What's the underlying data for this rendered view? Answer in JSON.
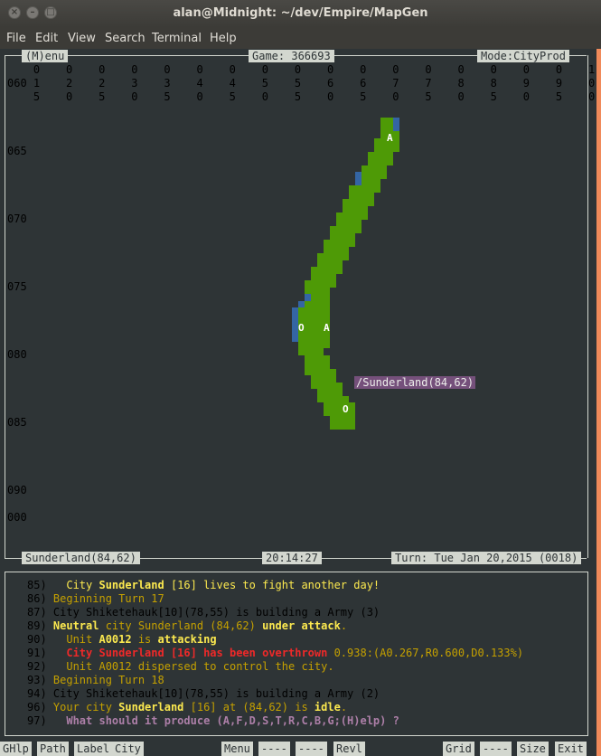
{
  "window": {
    "title": "alan@Midnight: ~/dev/Empire/MapGen",
    "menu": [
      "File",
      "Edit",
      "View",
      "Search",
      "Terminal",
      "Help"
    ]
  },
  "header": {
    "menu_label": "(M)enu",
    "game": "Game: 366693",
    "mode": "Mode:CityProd"
  },
  "columns": {
    "row0": "    0    0    0    0    0    0    0    0    0    0    0    0    0    0    0    0    0    1",
    "row1": "060 1    2    2    3    3    4    4    5    5    6    6    7    7    8    8    9    9    0",
    "row2": "    5    0    5    0    5    0    5    0    5    0    5    0    5    0    5    0    5    0"
  },
  "row_labels": [
    "065",
    "070",
    "075",
    "080",
    "085",
    "090",
    "000"
  ],
  "map": {
    "units": [
      {
        "glyph": "A"
      },
      {
        "glyph": "O"
      },
      {
        "glyph": "A"
      },
      {
        "glyph": "O"
      }
    ],
    "city_label": "/Sunderland(84,62)"
  },
  "status": {
    "location": "Sunderland(84,62)",
    "time": "20:14:27",
    "turn": "Turn: Tue Jan 20,2015 (0018)"
  },
  "log": [
    {
      "num": "85)",
      "indent": "  ",
      "parts": [
        {
          "t": "City ",
          "c": "yel"
        },
        {
          "t": "Sunderland",
          "c": "yel bold"
        },
        {
          "t": " [16] lives to fight another day!",
          "c": "yel"
        }
      ]
    },
    {
      "num": "86)",
      "indent": "",
      "parts": [
        {
          "t": "Beginning Turn 17",
          "c": "yel2"
        }
      ]
    },
    {
      "num": "87)",
      "indent": "",
      "parts": [
        {
          "t": "City Shiketehauk[10](78,55) is building a Army (3)",
          "c": ""
        }
      ]
    },
    {
      "num": "89)",
      "indent": "",
      "parts": [
        {
          "t": "Neutral",
          "c": "yel bold"
        },
        {
          "t": " city Sunderland (84,62) ",
          "c": "yel2"
        },
        {
          "t": "under attack",
          "c": "yel bold"
        },
        {
          "t": ".",
          "c": "yel2"
        }
      ]
    },
    {
      "num": "90)",
      "indent": "  ",
      "parts": [
        {
          "t": "Unit ",
          "c": "yel2"
        },
        {
          "t": "A0012",
          "c": "yel bold"
        },
        {
          "t": " is ",
          "c": "yel2"
        },
        {
          "t": "attacking",
          "c": "yel bold"
        }
      ]
    },
    {
      "num": "91)",
      "indent": "  ",
      "parts": [
        {
          "t": "City Sunderland [16] has been overthrown",
          "c": "red bold"
        },
        {
          "t": " 0.938:(A0.267,R0.600,D0.133%)",
          "c": "yel2"
        }
      ]
    },
    {
      "num": "92)",
      "indent": "  ",
      "parts": [
        {
          "t": "Unit A0012 dispersed to control the city.",
          "c": "yel2"
        }
      ]
    },
    {
      "num": "93)",
      "indent": "",
      "parts": [
        {
          "t": "Beginning Turn 18",
          "c": "yel2"
        }
      ]
    },
    {
      "num": "94)",
      "indent": "",
      "parts": [
        {
          "t": "City Shiketehauk[10](78,55) is building a Army (2)",
          "c": ""
        }
      ]
    },
    {
      "num": "96)",
      "indent": "",
      "parts": [
        {
          "t": "Your city ",
          "c": "yel2"
        },
        {
          "t": "Sunderland",
          "c": "yel bold"
        },
        {
          "t": " [16] at (84,62) is ",
          "c": "yel2"
        },
        {
          "t": "idle",
          "c": "yel bold"
        },
        {
          "t": ".",
          "c": "yel2"
        }
      ]
    },
    {
      "num": "97)",
      "indent": "  ",
      "parts": [
        {
          "t": "What should it produce (A,F,D,S,T,R,C,B,G;(H)elp) ?",
          "c": "pink bold"
        }
      ]
    }
  ],
  "function_keys": [
    "GHlp",
    "Path",
    "Label",
    "City",
    "Menu",
    "----",
    "----",
    "Revl",
    "Grid",
    "----",
    "Size",
    "Exit"
  ],
  "colors": {
    "land": "#4e9a06",
    "sea": "#3465a4",
    "city_label": "#75507b",
    "accent_right": "#f08a5a"
  }
}
